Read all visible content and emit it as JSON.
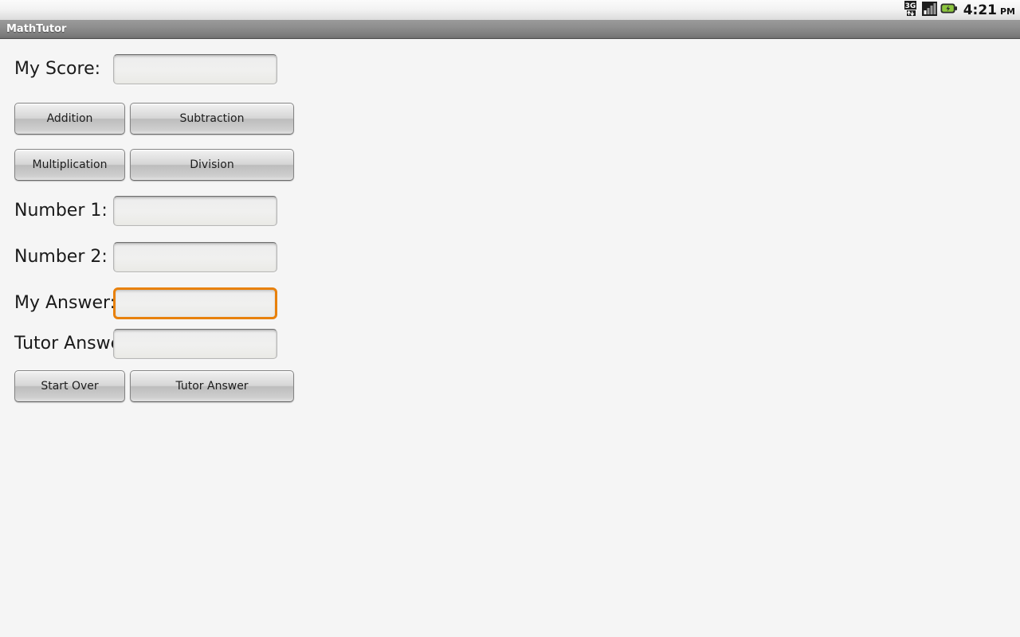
{
  "status_bar": {
    "icons": [
      {
        "name": "network-3g-icon",
        "label": "3G"
      },
      {
        "name": "signal-bars-icon",
        "label": "signal"
      },
      {
        "name": "battery-charging-icon",
        "label": "battery"
      }
    ],
    "clock": {
      "time": "4:21",
      "ampm": "PM"
    }
  },
  "title_bar": {
    "app_title": "MathTutor"
  },
  "colors": {
    "focus_orange": "#e8810c",
    "page_background": "#f5f5f5",
    "battery_green": "#7fbf1f"
  },
  "form": {
    "score": {
      "label": "My Score:",
      "value": "",
      "placeholder": ""
    },
    "operation_buttons": [
      {
        "name": "addition-button",
        "label": "Addition"
      },
      {
        "name": "subtraction-button",
        "label": "Subtraction"
      },
      {
        "name": "multiplication-button",
        "label": "Multiplication"
      },
      {
        "name": "division-button",
        "label": "Division"
      }
    ],
    "number1": {
      "label": "Number 1:",
      "value": "",
      "placeholder": ""
    },
    "number2": {
      "label": "Number 2:",
      "value": "",
      "placeholder": ""
    },
    "my_answer": {
      "label": "My Answer:",
      "value": "",
      "placeholder": "",
      "focused": true
    },
    "tutor_answer": {
      "label": "Tutor Answer:",
      "value": "",
      "placeholder": ""
    },
    "action_buttons": [
      {
        "name": "start-over-button",
        "label": "Start Over"
      },
      {
        "name": "tutor-answer-button",
        "label": "Tutor Answer"
      }
    ]
  }
}
